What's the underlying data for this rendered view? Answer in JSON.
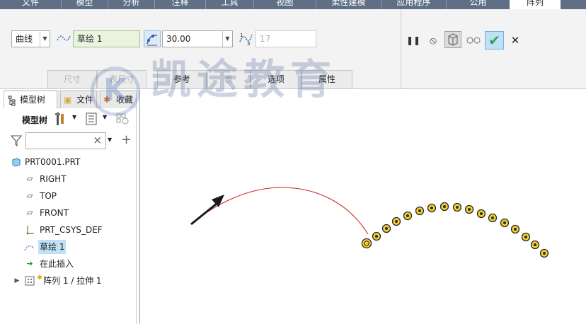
{
  "menu_tabs": [
    "文件",
    "模型",
    "分析",
    "注释",
    "工具",
    "视图",
    "柔性建模",
    "应用程序",
    "公用",
    "阵列"
  ],
  "ribbon": {
    "pattern_type": "曲线",
    "sketch_name": "草绘 1",
    "spacing_value": "30.00",
    "count_value": "17",
    "subtabs": [
      "尺寸",
      "表尺寸",
      "参考",
      "表",
      "选项",
      "属性"
    ],
    "pause_icon": "❚❚",
    "stop_icon": "⦸",
    "ok_icon": "✔",
    "cancel_icon": "✕"
  },
  "panel": {
    "tabs": [
      "模型树",
      "文件",
      "收藏"
    ],
    "toolbar_label": "模型树",
    "search_placeholder": "",
    "clear_icon": "×",
    "add_icon": "+"
  },
  "tree": {
    "root": "PRT0001.PRT",
    "items": [
      "RIGHT",
      "TOP",
      "FRONT",
      "PRT_CSYS_DEF",
      "草绘 1",
      "在此插入",
      "阵列 1 / 拉伸 1"
    ]
  },
  "watermark": "凯途教育",
  "watermark_logo": "K",
  "colors": {
    "menu_bg": "#5f6f86",
    "ok_green": "#2ea84a",
    "curve_red": "#d42020",
    "hole_fill": "#f2d12e",
    "selection": "#bfe1f7"
  }
}
